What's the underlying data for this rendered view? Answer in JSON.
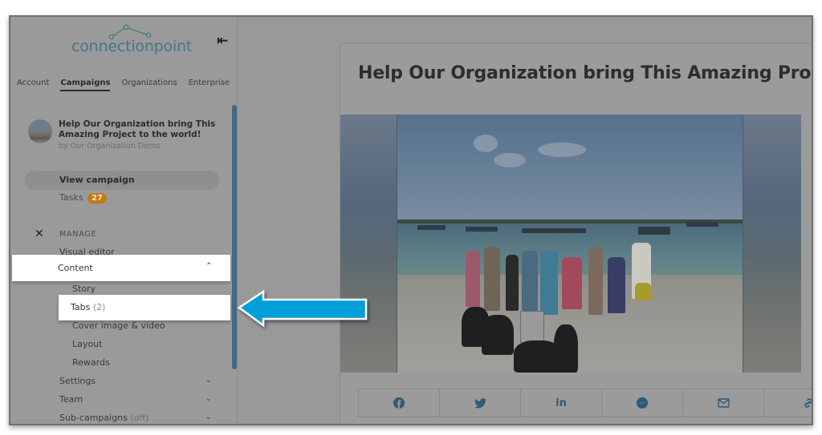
{
  "sidebar": {
    "logo_text": "connectionpoint",
    "collapse_icon": "collapse-left-icon",
    "nav_tabs": [
      {
        "label": "Account",
        "active": false
      },
      {
        "label": "Campaigns",
        "active": true
      },
      {
        "label": "Organizations",
        "active": false
      },
      {
        "label": "Enterprise",
        "active": false
      }
    ],
    "campaign": {
      "title": "Help Our Organization bring This Amazing Project to the world!",
      "by": "by Our Organization Demo"
    },
    "view_campaign": "View campaign",
    "tasks": {
      "label": "Tasks",
      "count": "27"
    },
    "manage": {
      "label": "MANAGE",
      "icon": "tools-icon"
    },
    "menu": {
      "visual_editor": "Visual editor",
      "content": "Content",
      "content_sub": {
        "story": "Story",
        "tabs": "Tabs",
        "tabs_count": "(2)",
        "cover": "Cover image & video",
        "layout": "Layout",
        "rewards": "Rewards"
      },
      "settings": "Settings",
      "team": "Team",
      "subcampaigns": "Sub-campaigns",
      "subcampaigns_state": "(off)"
    }
  },
  "main": {
    "title": "Help Our Organization bring This Amazing Pro",
    "share": [
      {
        "icon": "facebook-icon",
        "glyph": "f"
      },
      {
        "icon": "twitter-icon",
        "glyph": "t"
      },
      {
        "icon": "linkedin-icon",
        "glyph": "in"
      },
      {
        "icon": "messenger-icon",
        "glyph": "m"
      },
      {
        "icon": "email-icon",
        "glyph": "✉"
      },
      {
        "icon": "link-icon",
        "glyph": "🔗"
      }
    ]
  },
  "colors": {
    "accent_arrow": "#009fda",
    "badge": "#c27a12",
    "scrollbar": "#3f6a88",
    "logo": "#46758a"
  }
}
